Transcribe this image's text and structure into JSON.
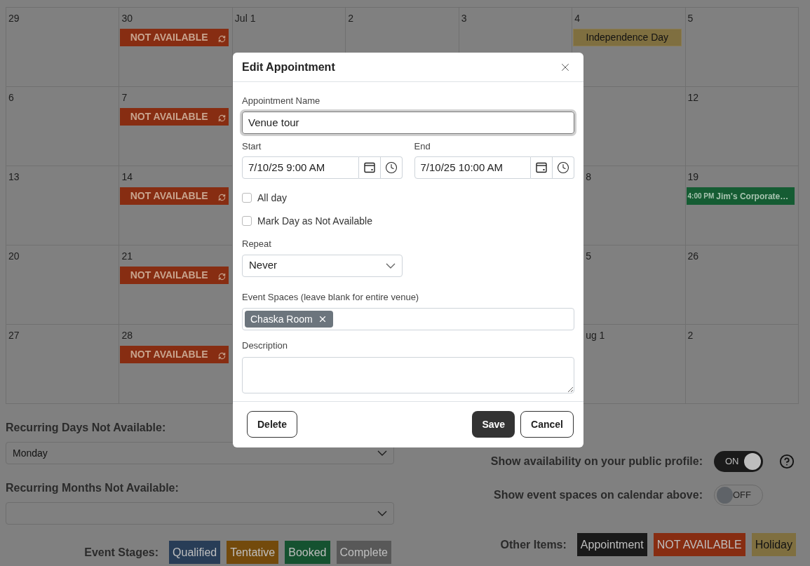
{
  "calendar": {
    "weeks": [
      [
        {
          "day": "29"
        },
        {
          "day": "30",
          "events": [
            {
              "kind": "unavailable",
              "label": "NOT AVAILABLE",
              "recurring": true
            }
          ]
        },
        {
          "day": "Jul 1"
        },
        {
          "day": "2"
        },
        {
          "day": "3"
        },
        {
          "day": "4",
          "events": [
            {
              "kind": "holiday",
              "label": "Independence Day"
            }
          ]
        },
        {
          "day": "5"
        }
      ],
      [
        {
          "day": "6"
        },
        {
          "day": "7",
          "events": [
            {
              "kind": "unavailable",
              "label": "NOT AVAILABLE",
              "recurring": true
            }
          ]
        },
        {
          "day": "12"
        }
      ],
      [
        {
          "day": "13"
        },
        {
          "day": "14",
          "events": [
            {
              "kind": "unavailable",
              "label": "NOT AVAILABLE",
              "recurring": true
            }
          ]
        },
        {
          "day": "8",
          "clipped": true
        },
        {
          "day": "19",
          "events": [
            {
              "kind": "booked",
              "time": "4:00 PM",
              "label": "Jim's Corporate…"
            }
          ]
        }
      ],
      [
        {
          "day": "20"
        },
        {
          "day": "21",
          "events": [
            {
              "kind": "unavailable",
              "label": "NOT AVAILABLE",
              "recurring": true
            }
          ]
        },
        {
          "day": "5",
          "clipped": true
        },
        {
          "day": "26"
        }
      ],
      [
        {
          "day": "27"
        },
        {
          "day": "28",
          "events": [
            {
              "kind": "unavailable",
              "label": "NOT AVAILABLE",
              "recurring": true
            }
          ]
        },
        {
          "day": "ug 1",
          "clipped": true
        },
        {
          "day": "2"
        }
      ]
    ]
  },
  "settings": {
    "recurring_days": {
      "label": "Recurring Days Not Available:",
      "value": "Monday"
    },
    "recurring_months": {
      "label": "Recurring Months Not Available:"
    }
  },
  "toggles": [
    {
      "label": "Show availability on your public profile:",
      "on": true,
      "text": "ON",
      "help": true
    },
    {
      "label": "Show event spaces on calendar above:",
      "on": false,
      "text": "OFF",
      "help": false
    }
  ],
  "legend": [
    {
      "label": "Event Stages:",
      "items": [
        {
          "label": "Qualified",
          "color": "#283d57"
        },
        {
          "label": "Tentative",
          "color": "#734a0c"
        },
        {
          "label": "Booked",
          "color": "#155230"
        },
        {
          "label": "Complete",
          "color": "#585858"
        }
      ]
    },
    {
      "label": "Other Items:",
      "items": [
        {
          "label": "Appointment",
          "color": "#1a1a1a"
        },
        {
          "label": "NOT AVAILABLE",
          "color": "#872d12"
        },
        {
          "label": "Holiday",
          "color": "#7f6f40"
        }
      ]
    }
  ],
  "dialog": {
    "title": "Edit Appointment",
    "name_field": {
      "label": "Appointment Name",
      "value": "Venue tour",
      "focused": true
    },
    "start": {
      "label": "Start",
      "value": "7/10/25 9:00 AM"
    },
    "end": {
      "label": "End",
      "value": "7/10/25 10:00 AM"
    },
    "checkboxes": [
      {
        "label": "All day",
        "checked": false
      },
      {
        "label": "Mark Day as Not Available",
        "checked": false
      }
    ],
    "repeat": {
      "label": "Repeat",
      "value": "Never"
    },
    "event_spaces": {
      "label": "Event Spaces (leave blank for entire venue)",
      "tags": [
        "Chaska Room"
      ]
    },
    "description": {
      "label": "Description"
    },
    "footer": {
      "left": [
        {
          "label": "Delete",
          "kind": "outline"
        }
      ],
      "right": [
        {
          "label": "Save",
          "kind": "primary"
        },
        {
          "label": "Cancel",
          "kind": "outline"
        }
      ]
    }
  }
}
